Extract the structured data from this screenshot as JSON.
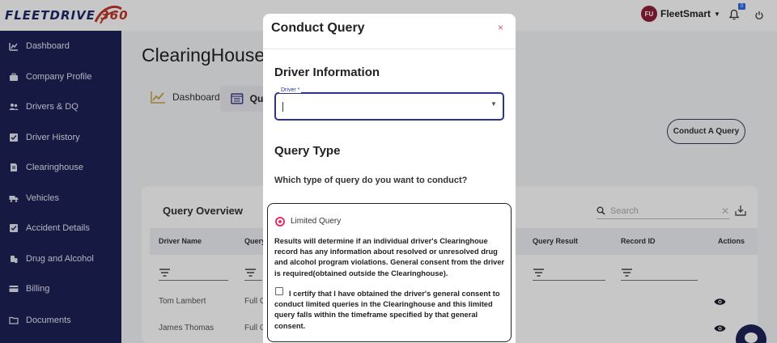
{
  "app": {
    "logo_main": "FLEETDRIVE ",
    "logo_num": "360",
    "user_initials": "FU",
    "user_name": "FleetSmart",
    "notification_count": "0"
  },
  "sidebar": {
    "items": [
      {
        "label": "Dashboard",
        "icon": "chart-icon"
      },
      {
        "label": "Company Profile",
        "icon": "briefcase-icon"
      },
      {
        "label": "Drivers & DQ",
        "icon": "users-icon"
      },
      {
        "label": "Driver History",
        "icon": "checkbox-icon"
      },
      {
        "label": "Clearinghouse",
        "icon": "document-icon"
      },
      {
        "label": "Vehicles",
        "icon": "truck-icon"
      },
      {
        "label": "Accident Details",
        "icon": "checkbox-icon"
      },
      {
        "label": "Drug and Alcohol",
        "icon": "pill-icon"
      },
      {
        "label": "Billing",
        "icon": "card-icon"
      },
      {
        "label": "Documents",
        "icon": "folder-icon"
      }
    ]
  },
  "main": {
    "page_title": "ClearingHouse",
    "tabs": [
      {
        "label": "Dashboard"
      },
      {
        "label": "Que"
      }
    ],
    "conduct_button": "Conduct A Query",
    "card_title": "Query Overview",
    "search_placeholder": "Search",
    "columns": [
      "Driver Name",
      "Query",
      "Query Result",
      "Record ID",
      "Actions"
    ],
    "rows": [
      {
        "driver": "Tom Lambert",
        "query": "Full C"
      },
      {
        "driver": "James Thomas",
        "query": "Full C"
      }
    ]
  },
  "modal": {
    "title": "Conduct Query",
    "close": "×",
    "driver_section": "Driver Information",
    "driver_label": "Driver *",
    "driver_value": "",
    "query_section": "Query Type",
    "question": "Which type of query do you want to conduct?",
    "option_label": "Limited Query",
    "option_selected": true,
    "option_description": "Results will determine if an individual driver's Clearinghoue record has any information about resolved or unresolved drug and alcohol program violations. General consent from the driver is required(obtained outside the Clearinghouse).",
    "certify_text": "I certify that I have obtained the driver's general consent to conduct limited queries in the Clearinghouse and this limited query falls within the timeframe specified by that general consent.",
    "certify_checked": false
  },
  "colors": {
    "sidebar": "#1d2256",
    "accent": "#e2306e",
    "field_border": "#2b3590"
  }
}
